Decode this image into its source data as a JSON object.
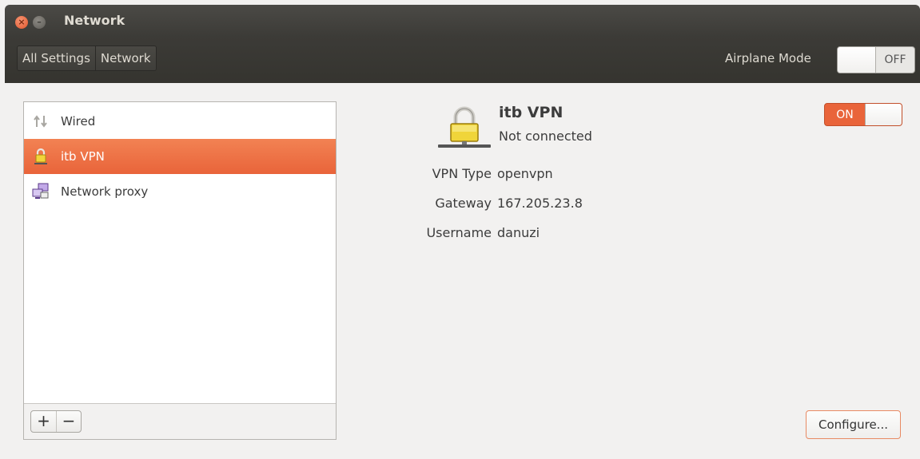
{
  "window": {
    "title": "Network",
    "close_glyph": "×",
    "minimize_glyph": "–"
  },
  "toolbar": {
    "breadcrumbs": [
      "All Settings",
      "Network"
    ],
    "airplane_mode_label": "Airplane Mode",
    "airplane_mode_state": "OFF"
  },
  "sidebar": {
    "items": [
      {
        "label": "Wired",
        "icon": "wired-arrows-icon",
        "selected": false
      },
      {
        "label": "itb VPN",
        "icon": "lock-icon",
        "selected": true
      },
      {
        "label": "Network proxy",
        "icon": "network-proxy-icon",
        "selected": false
      }
    ],
    "add_label": "+",
    "remove_label": "−"
  },
  "detail": {
    "name": "itb VPN",
    "status": "Not connected",
    "power_state": "ON",
    "fields": [
      {
        "label": "VPN Type",
        "value": "openvpn"
      },
      {
        "label": "Gateway",
        "value": "167.205.23.8"
      },
      {
        "label": "Username",
        "value": "danuzi"
      }
    ],
    "configure_label": "Configure..."
  },
  "colors": {
    "accent": "#e9643a",
    "titlebar": "#3c3b37",
    "window_bg": "#f2f1f0"
  }
}
